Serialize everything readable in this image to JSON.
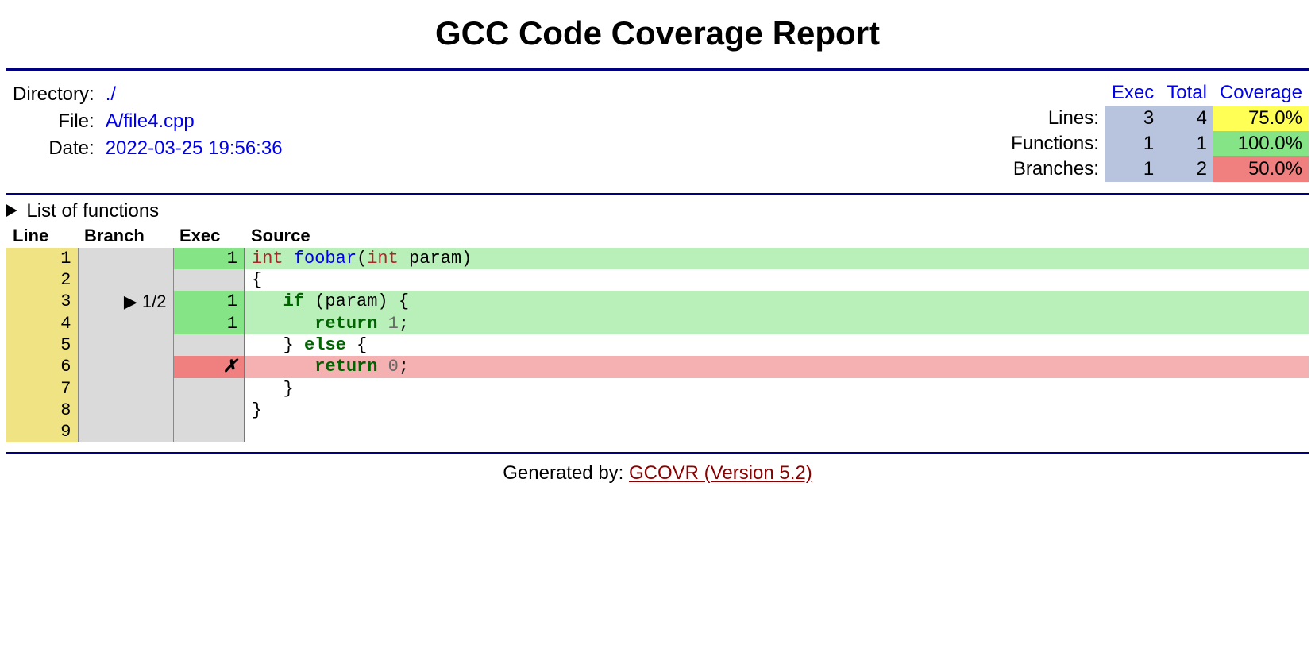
{
  "title": "GCC Code Coverage Report",
  "meta": {
    "directory_label": "Directory:",
    "directory_value": "./",
    "file_label": "File:",
    "file_value": "A/file4.cpp",
    "date_label": "Date:",
    "date_value": "2022-03-25 19:56:36"
  },
  "summary": {
    "header_exec": "Exec",
    "header_total": "Total",
    "header_coverage": "Coverage",
    "rows": [
      {
        "label": "Lines:",
        "exec": "3",
        "total": "4",
        "coverage": "75.0%",
        "cov_class": "cell-yellow"
      },
      {
        "label": "Functions:",
        "exec": "1",
        "total": "1",
        "coverage": "100.0%",
        "cov_class": "cell-green"
      },
      {
        "label": "Branches:",
        "exec": "1",
        "total": "2",
        "coverage": "50.0%",
        "cov_class": "cell-red"
      }
    ]
  },
  "functions_toggle_label": "List of functions",
  "listing_headers": {
    "line": "Line",
    "branch": "Branch",
    "exec": "Exec",
    "source": "Source"
  },
  "source_lines": [
    {
      "lineno": "1",
      "branch": "",
      "exec": "1",
      "exec_state": "hit",
      "src_state": "hit",
      "tokens": [
        [
          "type",
          "int"
        ],
        [
          "plain",
          " "
        ],
        [
          "fn",
          "foobar"
        ],
        [
          "plain",
          "("
        ],
        [
          "type",
          "int"
        ],
        [
          "plain",
          " param)"
        ]
      ]
    },
    {
      "lineno": "2",
      "branch": "",
      "exec": "",
      "exec_state": "none",
      "src_state": "none",
      "tokens": [
        [
          "plain",
          "{"
        ]
      ]
    },
    {
      "lineno": "3",
      "branch": "▶ 1/2",
      "exec": "1",
      "exec_state": "hit",
      "src_state": "hit",
      "tokens": [
        [
          "plain",
          "   "
        ],
        [
          "kw",
          "if"
        ],
        [
          "plain",
          " (param) {"
        ]
      ]
    },
    {
      "lineno": "4",
      "branch": "",
      "exec": "1",
      "exec_state": "hit",
      "src_state": "hit",
      "tokens": [
        [
          "plain",
          "      "
        ],
        [
          "kw",
          "return"
        ],
        [
          "plain",
          " "
        ],
        [
          "num",
          "1"
        ],
        [
          "plain",
          ";"
        ]
      ]
    },
    {
      "lineno": "5",
      "branch": "",
      "exec": "",
      "exec_state": "none",
      "src_state": "none",
      "tokens": [
        [
          "plain",
          "   } "
        ],
        [
          "kw",
          "else"
        ],
        [
          "plain",
          " {"
        ]
      ]
    },
    {
      "lineno": "6",
      "branch": "",
      "exec": "✗",
      "exec_state": "miss",
      "src_state": "miss",
      "tokens": [
        [
          "plain",
          "      "
        ],
        [
          "kw",
          "return"
        ],
        [
          "plain",
          " "
        ],
        [
          "num",
          "0"
        ],
        [
          "plain",
          ";"
        ]
      ]
    },
    {
      "lineno": "7",
      "branch": "",
      "exec": "",
      "exec_state": "none",
      "src_state": "none",
      "tokens": [
        [
          "plain",
          "   }"
        ]
      ]
    },
    {
      "lineno": "8",
      "branch": "",
      "exec": "",
      "exec_state": "none",
      "src_state": "none",
      "tokens": [
        [
          "plain",
          "}"
        ]
      ]
    },
    {
      "lineno": "9",
      "branch": "",
      "exec": "",
      "exec_state": "none",
      "src_state": "none",
      "tokens": []
    }
  ],
  "footer": {
    "generated_by_label": "Generated by: ",
    "link_text": "GCOVR (Version 5.2)"
  }
}
